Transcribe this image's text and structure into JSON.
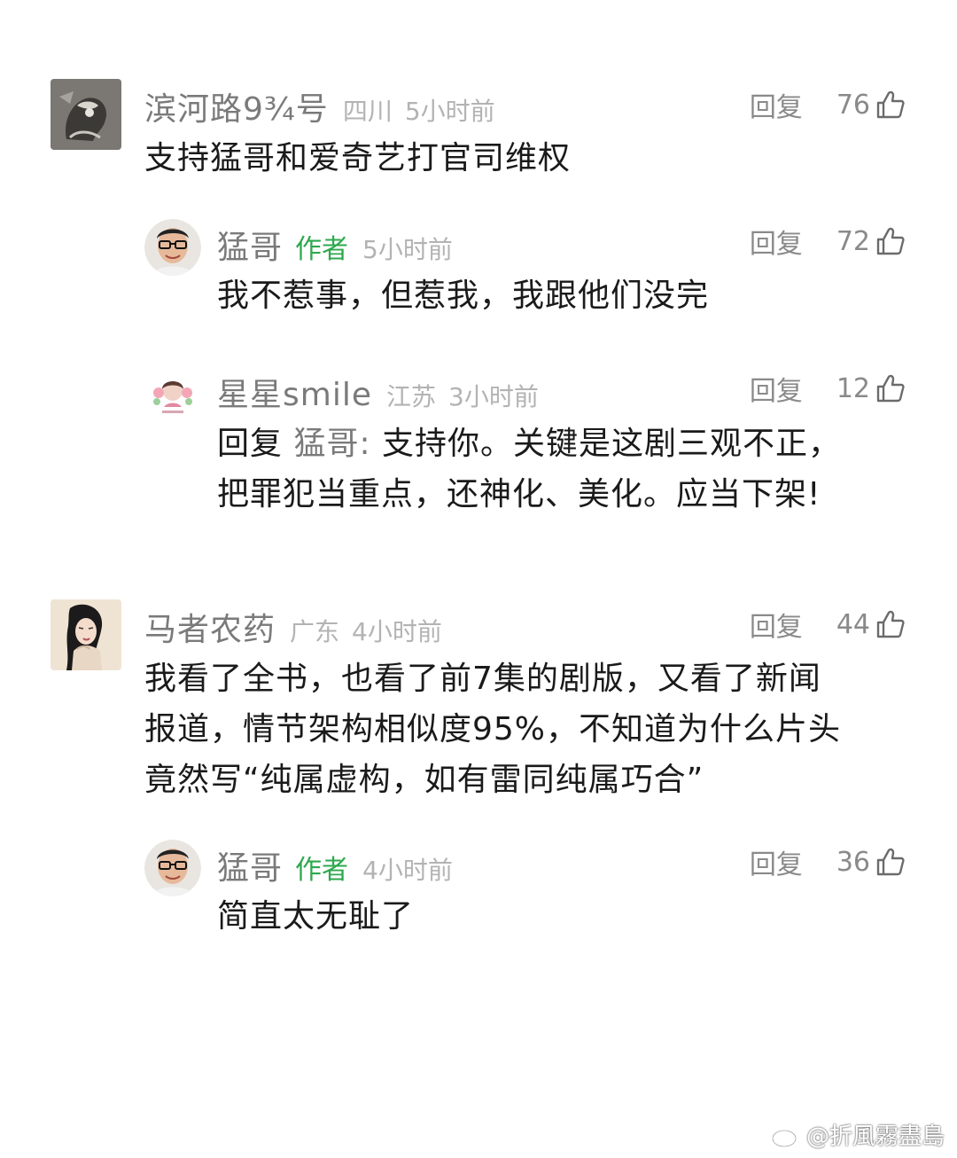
{
  "comments": [
    {
      "username": "滨河路9¾号",
      "location": "四川",
      "time": "5小时前",
      "reply_label": "回复",
      "likes": "76",
      "text": "支持猛哥和爱奇艺打官司维权"
    },
    {
      "username": "猛哥",
      "author_tag": "作者",
      "time": "5小时前",
      "reply_label": "回复",
      "likes": "72",
      "text": "我不惹事，但惹我，我跟他们没完"
    },
    {
      "username": "星星smile",
      "location": "江苏",
      "time": "3小时前",
      "reply_label": "回复",
      "likes": "12",
      "reply_prefix": "回复",
      "reply_target": " 猛哥: ",
      "text_line1": "支持你。关键是这剧三观不正，",
      "text_line2": "把罪犯当重点，还神化、美化。应当下架!"
    },
    {
      "username": "马者农药",
      "location": "广东",
      "time": "4小时前",
      "reply_label": "回复",
      "likes": "44",
      "text_line1": "我看了全书，也看了前7集的剧版，又看了新闻",
      "text_line2": "报道，情节架构相似度95%，不知道为什么片头",
      "text_line3": "竟然写“纯属虚构，如有雷同纯属巧合”"
    },
    {
      "username": "猛哥",
      "author_tag": "作者",
      "time": "4小时前",
      "reply_label": "回复",
      "likes": "36",
      "text": "简直太无耻了"
    }
  ],
  "watermark": {
    "text": "@折風霧盡島"
  },
  "colors": {
    "author_tag": "#2da84e",
    "username": "#7a7a7a",
    "meta": "#b3b3b3"
  }
}
